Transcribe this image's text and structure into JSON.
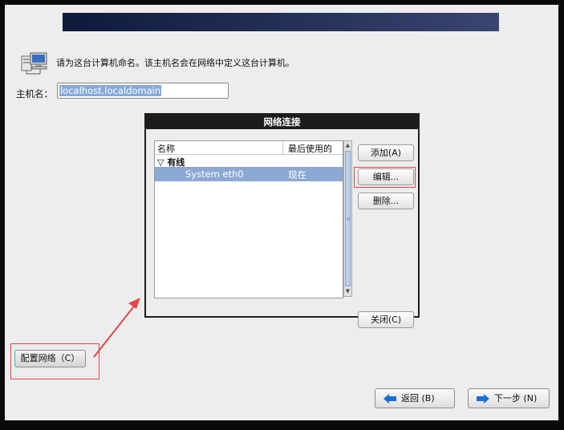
{
  "hint": {
    "text": "请为这台计算机命名。该主机名会在网络中定义这台计算机。"
  },
  "hostname": {
    "label": "主机名：",
    "value": "localhost.localdomain"
  },
  "dialog": {
    "title": "网络连接",
    "columns": {
      "name": "名称",
      "last_used": "最后使用的"
    },
    "group": {
      "label": "有线",
      "expander": "▽"
    },
    "connections": [
      {
        "name": "System eth0",
        "last_used": "现在"
      }
    ],
    "buttons": {
      "add": "添加(A)",
      "edit": "编辑...",
      "delete": "删除...",
      "close": "关闭(C)"
    }
  },
  "config_button": {
    "label": "配置网络（C）"
  },
  "nav": {
    "back": "返回 (B)",
    "next": "下一步 (N)"
  },
  "colors": {
    "highlight": "#e04646",
    "selection": "#8ca8d4",
    "banner": "#1a2448",
    "arrow": "#1a6fd0"
  },
  "icons": [
    "network-computers-icon",
    "back-arrow-icon",
    "forward-arrow-icon"
  ]
}
